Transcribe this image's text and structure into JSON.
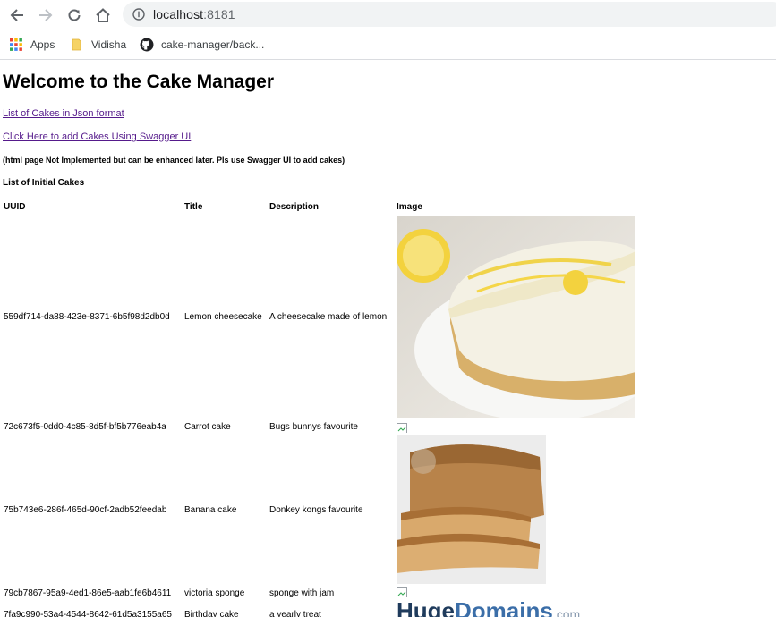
{
  "browser": {
    "url_host": "localhost",
    "url_port": ":8181",
    "bookmarks": [
      "Apps",
      "Vidisha",
      "cake-manager/back..."
    ]
  },
  "page": {
    "heading": "Welcome to the Cake Manager",
    "link_json": "List of Cakes in Json format",
    "link_swagger": "Click Here to add Cakes Using Swagger UI",
    "note": "(html page Not Implemented but can be enhanced later. Pls use Swagger UI to add cakes)",
    "list_title": "List of Initial Cakes",
    "columns": [
      "UUID",
      "Title",
      "Description",
      "Image"
    ],
    "rows": [
      {
        "uuid": "559df714-da88-423e-8371-6b5f98d2db0d",
        "title": "Lemon cheesecake",
        "description": "A cheesecake made of lemon",
        "image": "lemon-cheesecake-photo"
      },
      {
        "uuid": "72c673f5-0dd0-4c85-8d5f-bf5b776eab4a",
        "title": "Carrot cake",
        "description": "Bugs bunnys favourite",
        "image": "broken-image-icon"
      },
      {
        "uuid": "75b743e6-286f-465d-90cf-2adb52feedab",
        "title": "Banana cake",
        "description": "Donkey kongs favourite",
        "image": "banana-cake-photo"
      },
      {
        "uuid": "79cb7867-95a9-4ed1-86e5-aab1fe6b4611",
        "title": "victoria sponge",
        "description": "sponge with jam",
        "image": "broken-image-icon"
      },
      {
        "uuid": "7fa9c990-53a4-4544-8642-61d5a3155a65",
        "title": "Birthday cake",
        "description": "a yearly treat",
        "image": "hugedomains-logo"
      }
    ],
    "logo_text_1": "Huge",
    "logo_text_2": "Domains",
    "logo_text_3": ".com"
  },
  "colors": {
    "link_visited": "#551a8b",
    "omnibox_bg": "#f1f3f4",
    "logo_dark": "#1f3b5c",
    "logo_blue": "#3b6ea8"
  }
}
